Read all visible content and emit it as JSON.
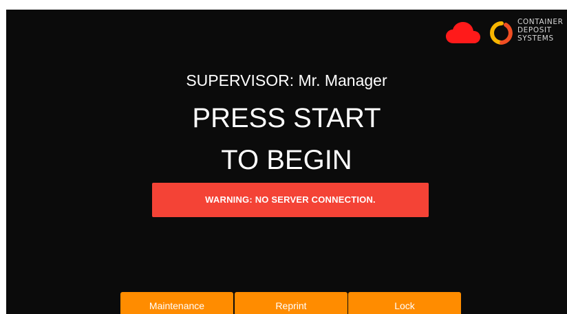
{
  "header": {
    "cloud_status_icon": "cloud-icon",
    "cloud_status_color": "#ff1a1a",
    "logo": {
      "line1": "CONTAINER",
      "line2": "DEPOSIT",
      "line3": "SYSTEMS",
      "mark_colors": [
        "#f7b500",
        "#f04e23"
      ]
    }
  },
  "main": {
    "supervisor_text": "SUPERVISOR: Mr. Manager",
    "prompt_line1": "PRESS START",
    "prompt_line2": "TO BEGIN",
    "warning_text": "WARNING: NO SERVER CONNECTION.",
    "warning_color": "#f44336"
  },
  "footer": {
    "buttons": [
      {
        "label": "Maintenance"
      },
      {
        "label": "Reprint"
      },
      {
        "label": "Lock"
      }
    ],
    "button_color": "#ff8c00"
  }
}
